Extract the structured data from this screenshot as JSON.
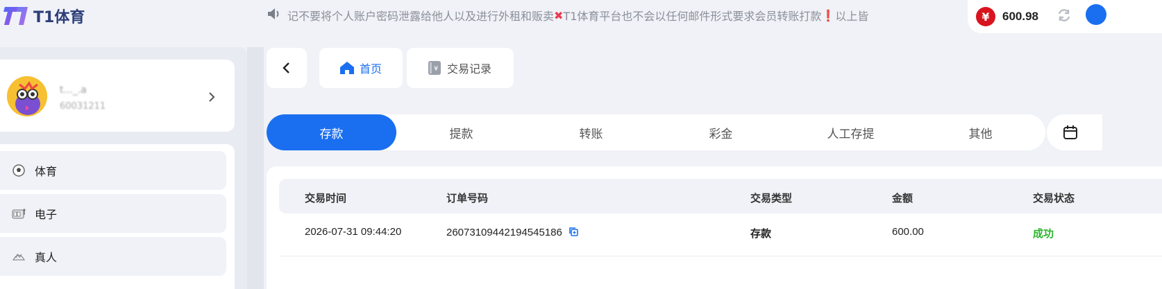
{
  "brand": {
    "name": "T1体育"
  },
  "notice": {
    "text_1": "记不要将个人账户密码泄露给他人以及进行外租和贩卖",
    "text_2": "T1体育平台也不会以任何邮件形式要求会员转账打款",
    "text_3": "以上皆"
  },
  "wallet": {
    "currency_symbol": "¥",
    "balance": "600.98"
  },
  "profile": {
    "username": "t..._.a",
    "user_id": "60031211"
  },
  "sidebar": {
    "items": [
      {
        "label": "体育",
        "icon": "soccer-icon"
      },
      {
        "label": "电子",
        "icon": "slot-machine-icon"
      },
      {
        "label": "真人",
        "icon": "live-dealer-icon"
      }
    ]
  },
  "nav": {
    "home_label": "首页",
    "records_label": "交易记录"
  },
  "type_tabs": [
    "存款",
    "提款",
    "转账",
    "彩金",
    "人工存提",
    "其他"
  ],
  "table": {
    "headers": [
      "交易时间",
      "订单号码",
      "交易类型",
      "金额",
      "交易状态"
    ],
    "rows": [
      {
        "time": "2026-07-31 09:44:20",
        "order": "26073109442194545186",
        "type": "存款",
        "amount": "600.00",
        "status": "成功"
      }
    ]
  },
  "colors": {
    "accent": "#1a6ff0",
    "success": "#2cb52c",
    "danger": "#d8141f"
  }
}
